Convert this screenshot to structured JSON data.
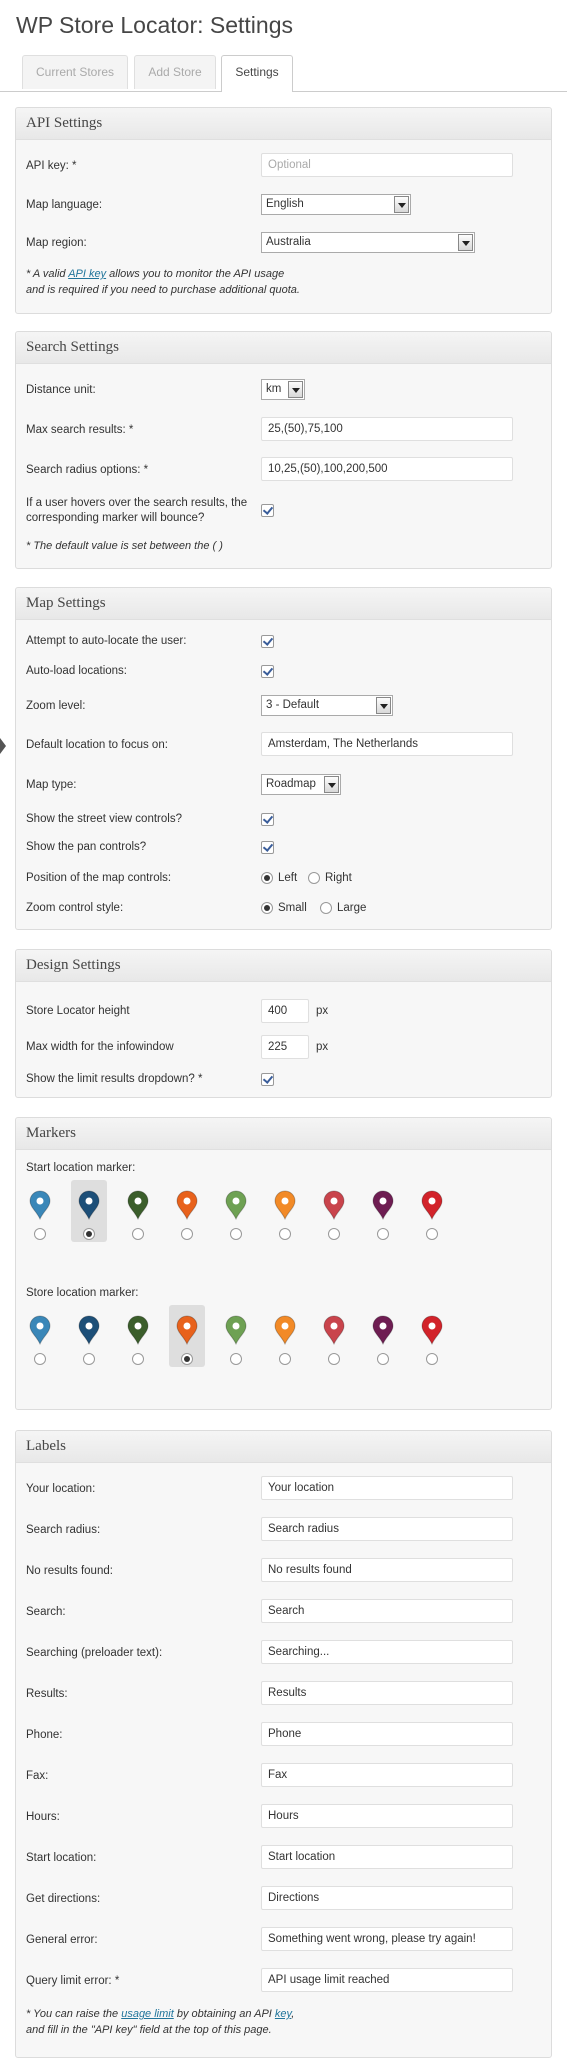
{
  "page": {
    "title": "WP Store Locator: Settings"
  },
  "tabs": [
    {
      "label": "Current Stores",
      "active": false
    },
    {
      "label": "Add Store",
      "active": false
    },
    {
      "label": "Settings",
      "active": true
    }
  ],
  "api": {
    "heading": "API Settings",
    "key_label": "API key: *",
    "key_placeholder": "Optional",
    "language_label": "Map language:",
    "language_value": "English",
    "region_label": "Map region:",
    "region_value": "Australia",
    "note_prefix": "* A valid ",
    "note_link": "API key",
    "note_suffix": " allows you to monitor the API usage",
    "note_line2": "and is required if you need to purchase additional quota."
  },
  "search": {
    "heading": "Search Settings",
    "distance_label": "Distance unit:",
    "distance_value": "km",
    "max_label": "Max search results: *",
    "max_value": "25,(50),75,100",
    "radius_label": "Search radius options: *",
    "radius_value": "10,25,(50),100,200,500",
    "bounce_label": "If a user hovers over the search results, the corresponding marker will bounce?",
    "note": "* The default value is set between the ( )"
  },
  "map": {
    "heading": "Map Settings",
    "autolocate_label": "Attempt to auto-locate the user:",
    "autoload_label": "Auto-load locations:",
    "zoom_label": "Zoom level:",
    "zoom_value": "3 - Default",
    "default_loc_label": "Default location to focus on:",
    "default_loc_value": "Amsterdam, The Netherlands",
    "type_label": "Map type:",
    "type_value": "Roadmap",
    "streetview_label": "Show the street view controls?",
    "pan_label": "Show the pan controls?",
    "position_label": "Position of the map controls:",
    "position_left": "Left",
    "position_right": "Right",
    "zoomstyle_label": "Zoom control style:",
    "zoomstyle_small": "Small",
    "zoomstyle_large": "Large"
  },
  "design": {
    "heading": "Design Settings",
    "height_label": "Store Locator height",
    "height_value": "400",
    "width_label": "Max width for the infowindow",
    "width_value": "225",
    "unit": "px",
    "limit_label": "Show the limit results dropdown? *"
  },
  "markers": {
    "heading": "Markers",
    "start_label": "Start location marker:",
    "store_label": "Store location marker:",
    "colors": [
      "#3a87b8",
      "#1d4f78",
      "#3b5e2b",
      "#e8621c",
      "#6ea153",
      "#f28a27",
      "#c9444c",
      "#6e1d52",
      "#d2232a"
    ],
    "start_selected": 1,
    "store_selected": 3
  },
  "labels": {
    "heading": "Labels",
    "rows": [
      {
        "label": "Your location:",
        "value": "Your location"
      },
      {
        "label": "Search radius:",
        "value": "Search radius"
      },
      {
        "label": "No results found:",
        "value": "No results found"
      },
      {
        "label": "Search:",
        "value": "Search"
      },
      {
        "label": "Searching (preloader text):",
        "value": "Searching..."
      },
      {
        "label": "Results:",
        "value": "Results"
      },
      {
        "label": "Phone:",
        "value": "Phone"
      },
      {
        "label": "Fax:",
        "value": "Fax"
      },
      {
        "label": "Hours:",
        "value": "Hours"
      },
      {
        "label": "Start location:",
        "value": "Start location"
      },
      {
        "label": "Get directions:",
        "value": "Directions"
      },
      {
        "label": "General error:",
        "value": "Something went wrong, please try again!"
      },
      {
        "label": "Query limit error: *",
        "value": "API usage limit reached"
      }
    ],
    "note_a": "* You can raise the ",
    "note_link1": "usage limit",
    "note_b": " by obtaining an API ",
    "note_link2": "key",
    "note_c": ",",
    "note_line2": "and fill in the \"API key\" field at the top of this page."
  }
}
